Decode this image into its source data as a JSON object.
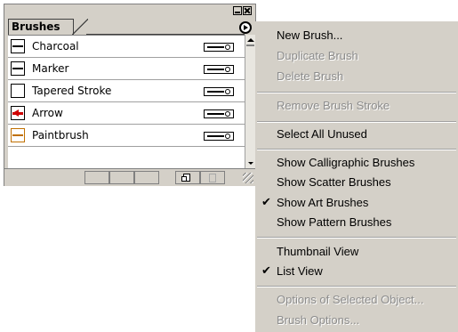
{
  "palette": {
    "tab_label": "Brushes",
    "brushes": [
      {
        "label": "Charcoal",
        "thumb": "charcoal"
      },
      {
        "label": "Marker",
        "thumb": "marker"
      },
      {
        "label": "Tapered Stroke",
        "thumb": "taper"
      },
      {
        "label": "Arrow",
        "thumb": "arrow"
      },
      {
        "label": "Paintbrush",
        "thumb": "paint"
      }
    ],
    "row_icon": "art-brush-type-icon",
    "bottom_icons": [
      "new-brush-icon",
      "delete-brush-icon",
      "resize-grip-icon"
    ],
    "titlebar_icons": [
      "minimize-icon",
      "close-icon"
    ],
    "menu_button_icon": "palette-menu-arrow-icon"
  },
  "menu": {
    "items": [
      {
        "label": "New Brush...",
        "enabled": true,
        "checked": false
      },
      {
        "label": "Duplicate Brush",
        "enabled": false,
        "checked": false
      },
      {
        "label": "Delete Brush",
        "enabled": false,
        "checked": false
      },
      {
        "label": "Remove Brush Stroke",
        "enabled": false,
        "checked": false
      },
      {
        "label": "Select All Unused",
        "enabled": true,
        "checked": false
      },
      {
        "label": "Show Calligraphic Brushes",
        "enabled": true,
        "checked": false
      },
      {
        "label": "Show Scatter Brushes",
        "enabled": true,
        "checked": false
      },
      {
        "label": "Show Art Brushes",
        "enabled": true,
        "checked": true
      },
      {
        "label": "Show Pattern Brushes",
        "enabled": true,
        "checked": false
      },
      {
        "label": "Thumbnail View",
        "enabled": true,
        "checked": false
      },
      {
        "label": "List View",
        "enabled": true,
        "checked": true
      },
      {
        "label": "Options of Selected Object...",
        "enabled": false,
        "checked": false
      },
      {
        "label": "Brush Options...",
        "enabled": false,
        "checked": false
      }
    ],
    "check_glyph": "✔",
    "disabled_color": "#8c8c8c"
  }
}
